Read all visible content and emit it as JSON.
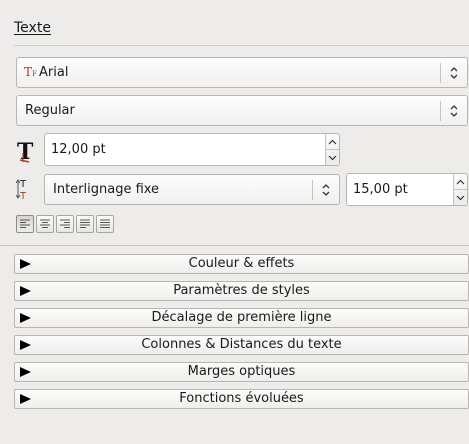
{
  "panel": {
    "title": "Texte",
    "font_family": {
      "value": "Arial",
      "icon": "font-family-icon"
    },
    "font_style": {
      "value": "Regular"
    },
    "font_size": {
      "value": "12,00 pt",
      "icon": "font-size-icon"
    },
    "line_spacing": {
      "mode": "Interlignage fixe",
      "value": "15,00 pt",
      "icon": "line-spacing-icon"
    },
    "alignment": {
      "options": [
        "align-left",
        "align-center",
        "align-right",
        "align-justify",
        "align-force-justify"
      ],
      "active_index": 0
    },
    "sections": [
      {
        "label": "Couleur & effets",
        "expanded": false
      },
      {
        "label": "Paramètres de styles",
        "expanded": false
      },
      {
        "label": "Décalage de première ligne",
        "expanded": false
      },
      {
        "label": "Colonnes & Distances du texte",
        "expanded": false
      },
      {
        "label": "Marges optiques",
        "expanded": false
      },
      {
        "label": "Fonctions évoluées",
        "expanded": false
      }
    ]
  },
  "colors": {
    "font_icon_red": "#b33a2a",
    "border": "#b9b6b2",
    "background": "#edeceb"
  }
}
